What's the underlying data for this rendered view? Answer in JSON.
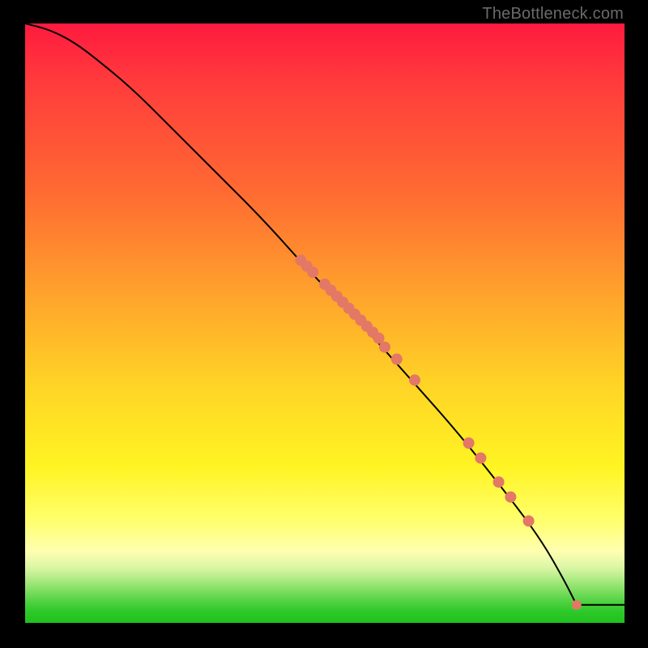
{
  "watermark": "TheBottleneck.com",
  "colors": {
    "frame_bg": "#000000",
    "curve": "#000000",
    "point": "#e27865"
  },
  "chart_data": {
    "type": "line",
    "title": "",
    "xlabel": "",
    "ylabel": "",
    "xlim": [
      0,
      100
    ],
    "ylim": [
      0,
      100
    ],
    "curve": {
      "note": "Monotonically decreasing curve from top-left to bottom-right; flat floor after x≈92.",
      "x": [
        0,
        4,
        8,
        12,
        18,
        25,
        32,
        40,
        48,
        56,
        64,
        72,
        80,
        86,
        90,
        92
      ],
      "y": [
        100,
        99,
        97,
        94,
        89,
        82,
        75,
        67,
        58,
        50,
        41,
        32,
        22,
        14,
        7,
        3
      ]
    },
    "floor": {
      "x_start": 92,
      "x_end": 100,
      "y": 3
    },
    "points": {
      "note": "Scatter points lying on the descending curve segment",
      "x": [
        46,
        47,
        48,
        50,
        51,
        52,
        53,
        54,
        55,
        56,
        57,
        58,
        59,
        60,
        62,
        65,
        74,
        76,
        79,
        81,
        84,
        92
      ],
      "y": [
        60.5,
        59.5,
        58.5,
        56.5,
        55.5,
        54.5,
        53.5,
        52.5,
        51.5,
        50.5,
        49.5,
        48.5,
        47.5,
        46.0,
        44.0,
        40.5,
        30.0,
        27.5,
        23.5,
        21.0,
        17.0,
        3.0
      ]
    }
  }
}
